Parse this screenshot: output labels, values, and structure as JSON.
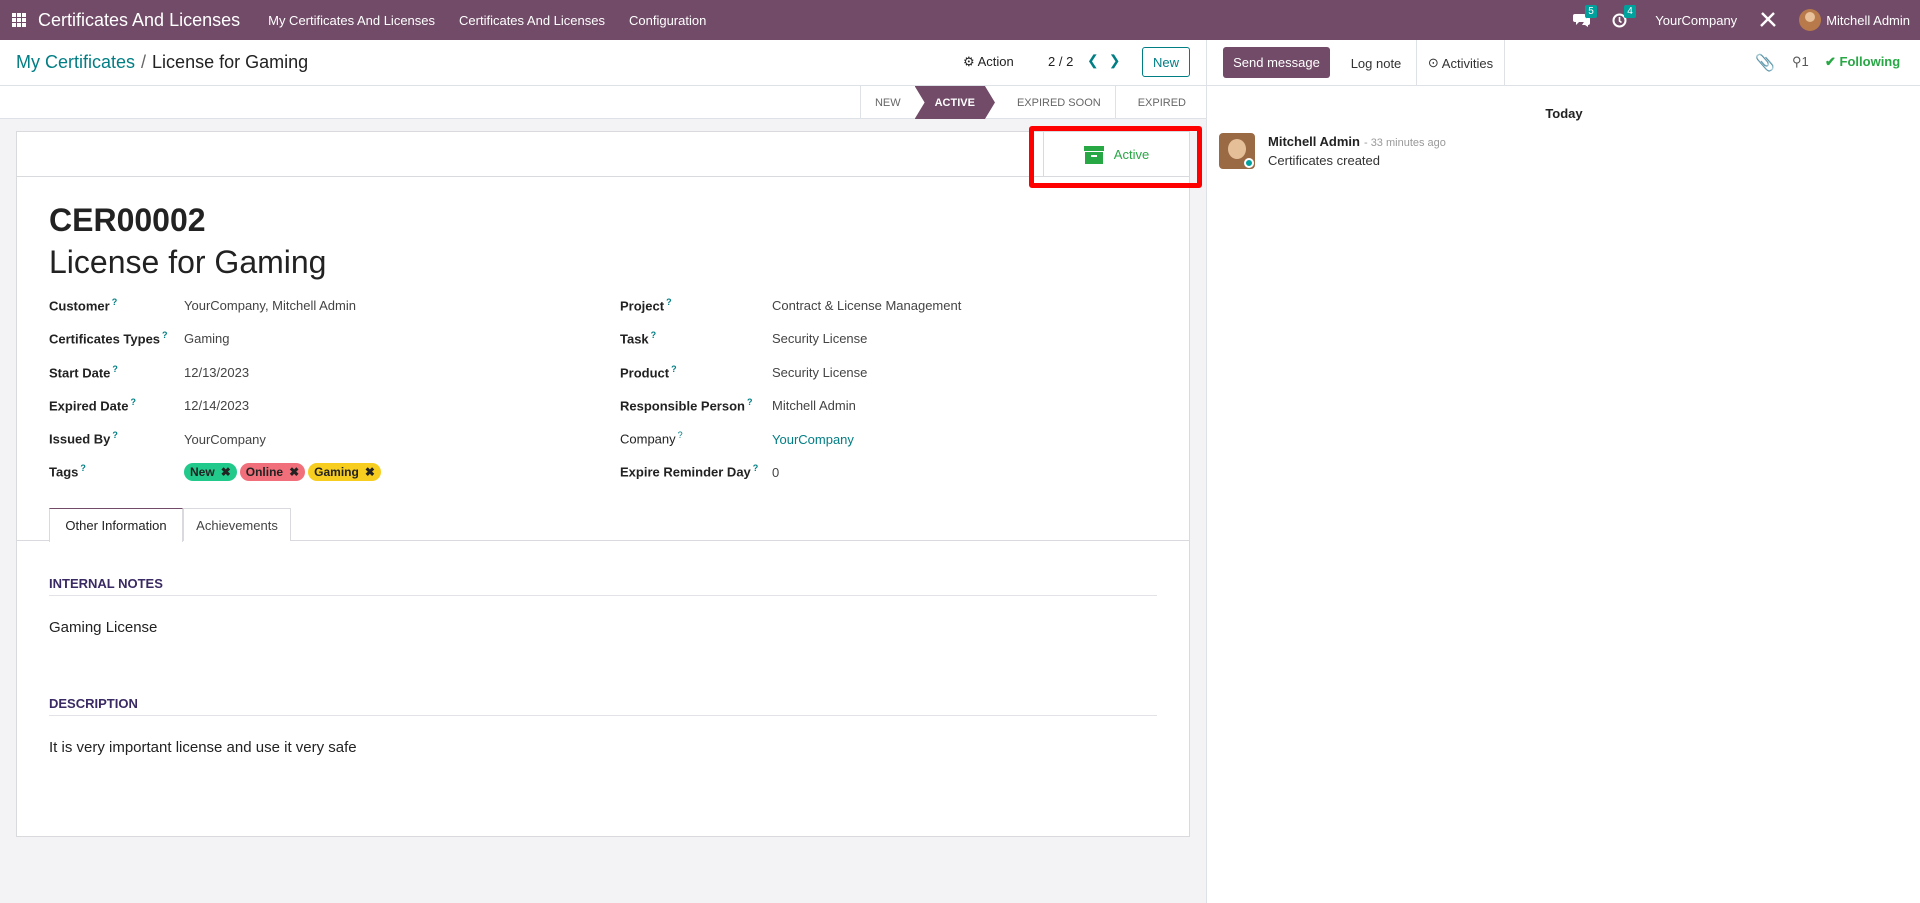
{
  "navbar": {
    "brand": "Certificates And Licenses",
    "menu": [
      "My Certificates And Licenses",
      "Certificates And Licenses",
      "Configuration"
    ],
    "messages_count": "5",
    "activities_count": "4",
    "company": "YourCompany",
    "user": "Mitchell Admin"
  },
  "control": {
    "breadcrumb_parent": "My Certificates",
    "breadcrumb_sep": "/",
    "breadcrumb_current": "License for Gaming",
    "action_label": "Action",
    "pager": "2 / 2",
    "new_label": "New"
  },
  "stages": {
    "items": [
      "NEW",
      "ACTIVE",
      "EXPIRED SOON",
      "EXPIRED"
    ],
    "current": "ACTIVE"
  },
  "smart_button": {
    "label": "Active"
  },
  "record": {
    "code": "CER00002",
    "name": "License for Gaming"
  },
  "fields_left": [
    {
      "label": "Customer",
      "value": "YourCompany, Mitchell Admin"
    },
    {
      "label": "Certificates Types",
      "value": "Gaming"
    },
    {
      "label": "Start Date",
      "value": "12/13/2023"
    },
    {
      "label": "Expired Date",
      "value": "12/14/2023"
    },
    {
      "label": "Issued By",
      "value": "YourCompany"
    },
    {
      "label": "Tags",
      "value": ""
    }
  ],
  "fields_right": [
    {
      "label": "Project",
      "value": "Contract & License Management"
    },
    {
      "label": "Task",
      "value": "Security License"
    },
    {
      "label": "Product",
      "value": "Security License"
    },
    {
      "label": "Responsible Person",
      "value": "Mitchell Admin"
    },
    {
      "label": "Company",
      "value": "YourCompany"
    },
    {
      "label": "Expire Reminder Day",
      "value": "0"
    }
  ],
  "tags": [
    {
      "label": "New",
      "color": "#21c98b"
    },
    {
      "label": "Online",
      "color": "#f06f7a"
    },
    {
      "label": "Gaming",
      "color": "#f7cd1f"
    }
  ],
  "tabs": [
    "Other Information",
    "Achievements"
  ],
  "sections": {
    "notes_title": "INTERNAL NOTES",
    "notes_text": "Gaming License",
    "desc_title": "DESCRIPTION",
    "desc_text": "It is very important license and use it very safe"
  },
  "chatter": {
    "send_message": "Send message",
    "log_note": "Log note",
    "activities": "Activities",
    "followers_count": "1",
    "following": "Following",
    "today": "Today",
    "message": {
      "author": "Mitchell Admin",
      "time": "- 33 minutes ago",
      "body": "Certificates created"
    }
  },
  "colors": {
    "brand": "#714b67",
    "link": "#017e84",
    "success": "#28a745",
    "highlight": "#ff0000"
  }
}
